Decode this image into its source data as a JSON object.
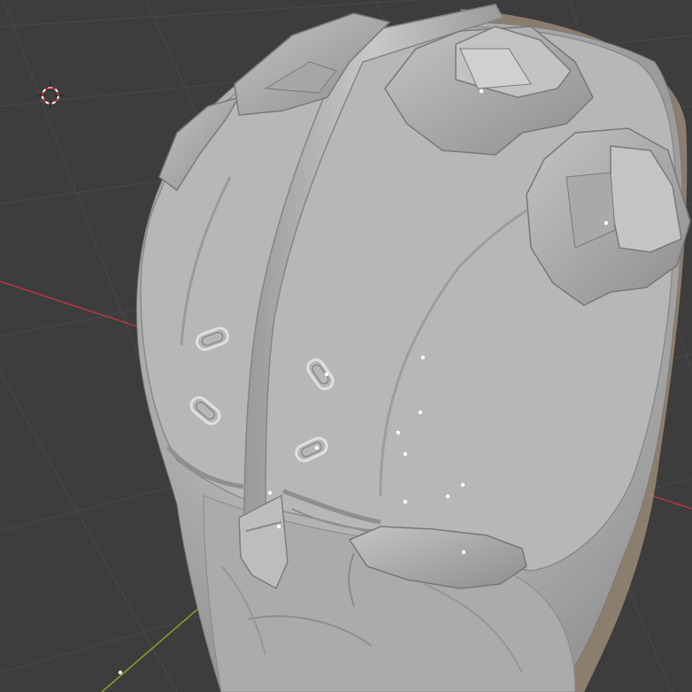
{
  "viewport": {
    "background": "#3d3d3d",
    "grid_color": "#4a4a4a",
    "x_axis_color": "#b33a40",
    "y_axis_color": "#7fa52d",
    "mesh_color": "#b3b3b3"
  },
  "objects": {
    "main_object": "helmet-sculpt-mesh",
    "cursor": "3d-cursor"
  }
}
